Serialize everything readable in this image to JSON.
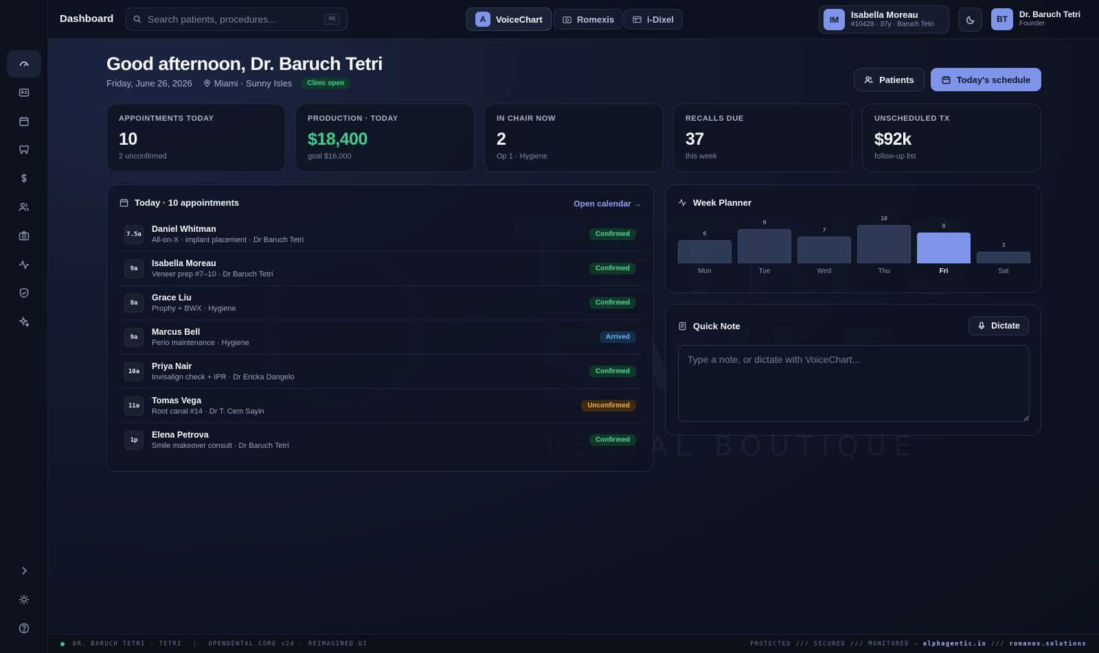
{
  "topbar": {
    "title": "Dashboard",
    "search_placeholder": "Search patients, procedures...",
    "search_shortcut": "⌘K",
    "apps": [
      {
        "label": "VoiceChart",
        "badge": "A",
        "icon": "voicechart-icon",
        "active": true
      },
      {
        "label": "Romexis",
        "icon": "camera-icon",
        "active": false
      },
      {
        "label": "i-Dixel",
        "icon": "image-window-icon",
        "active": false
      }
    ],
    "patient": {
      "initials": "IM",
      "name": "Isabella Moreau",
      "sub": "#10428 · 37y · Baruch Tetri"
    },
    "user": {
      "initials": "BT",
      "name": "Dr. Baruch Tetri",
      "role": "Founder"
    }
  },
  "sidebar": {
    "items": [
      {
        "icon": "gauge-icon",
        "active": true
      },
      {
        "icon": "id-card-icon"
      },
      {
        "icon": "calendar-icon"
      },
      {
        "icon": "tooth-icon"
      },
      {
        "icon": "dollar-icon"
      },
      {
        "icon": "users-icon"
      },
      {
        "icon": "camera-icon"
      },
      {
        "icon": "activity-icon"
      },
      {
        "icon": "shield-icon"
      },
      {
        "icon": "sparkle-icon"
      }
    ],
    "bottom": [
      {
        "icon": "chevron-right-icon"
      },
      {
        "icon": "sun-icon"
      },
      {
        "icon": "help-icon"
      }
    ]
  },
  "watermark": {
    "line1": "TETRI'S",
    "line2": "SMILE",
    "line3": "DENTAL BOUTIQUE"
  },
  "greeting": {
    "title": "Good afternoon, Dr. Baruch Tetri",
    "date": "Friday, June 26, 2026",
    "location": "Miami · Sunny Isles",
    "clinic_status": "Clinic open"
  },
  "actions": {
    "patients_label": "Patients",
    "schedule_label": "Today's schedule"
  },
  "kpis": [
    {
      "label": "APPOINTMENTS TODAY",
      "value": "10",
      "sub": "2 unconfirmed",
      "accent": false
    },
    {
      "label": "PRODUCTION · TODAY",
      "value": "$18,400",
      "sub": "goal $16,000",
      "accent": true
    },
    {
      "label": "IN CHAIR NOW",
      "value": "2",
      "sub": "Op 1 · Hygiene",
      "accent": false
    },
    {
      "label": "RECALLS DUE",
      "value": "37",
      "sub": "this week",
      "accent": false
    },
    {
      "label": "UNSCHEDULED TX",
      "value": "$92k",
      "sub": "follow-up list",
      "accent": false
    }
  ],
  "appointments": {
    "title": "Today · 10 appointments",
    "open_link": "Open calendar →",
    "items": [
      {
        "time": "7.5a",
        "name": "Daniel Whitman",
        "desc": "All-on-X · implant placement · Dr Baruch Tetri",
        "status": "Confirmed",
        "kind": "confirmed"
      },
      {
        "time": "9a",
        "name": "Isabella Moreau",
        "desc": "Veneer prep #7–10 · Dr Baruch Tetri",
        "status": "Confirmed",
        "kind": "confirmed"
      },
      {
        "time": "8a",
        "name": "Grace Liu",
        "desc": "Prophy + BWX · Hygiene",
        "status": "Confirmed",
        "kind": "confirmed"
      },
      {
        "time": "9a",
        "name": "Marcus Bell",
        "desc": "Perio maintenance · Hygiene",
        "status": "Arrived",
        "kind": "arrived"
      },
      {
        "time": "10a",
        "name": "Priya Nair",
        "desc": "Invisalign check + IPR · Dr Ericka Dangelo",
        "status": "Confirmed",
        "kind": "confirmed"
      },
      {
        "time": "11a",
        "name": "Tomas Vega",
        "desc": "Root canal #14 · Dr T. Cem Sayin",
        "status": "Unconfirmed",
        "kind": "unconfirmed"
      },
      {
        "time": "1p",
        "name": "Elena Petrova",
        "desc": "Smile makeover consult · Dr Baruch Tetri",
        "status": "Confirmed",
        "kind": "confirmed"
      }
    ]
  },
  "week_planner": {
    "title": "Week Planner",
    "days": [
      {
        "day": "Mon",
        "count": 6,
        "highlight": false
      },
      {
        "day": "Tue",
        "count": 9,
        "highlight": false
      },
      {
        "day": "Wed",
        "count": 7,
        "highlight": false
      },
      {
        "day": "Thu",
        "count": 10,
        "highlight": false
      },
      {
        "day": "Fri",
        "count": 8,
        "highlight": true
      },
      {
        "day": "Sat",
        "count": 3,
        "highlight": false
      }
    ]
  },
  "quick_note": {
    "title": "Quick Note",
    "dictate_label": "Dictate",
    "placeholder": "Type a note, or dictate with VoiceChart..."
  },
  "footer": {
    "left_a": "DR. BARUCH TETRI · TETRI",
    "left_b": "OPENDENTAL CORE v24 · REIMAGINED UI",
    "right_prefix": "PROTECTED /// SECURED /// MONITORED — ",
    "link1": "alphagentic.io",
    "sep": " /// ",
    "link2": "romanov.solutions"
  },
  "colors": {
    "accent": "#7f95e9",
    "success": "#3ed08f",
    "warning": "#f1b04d",
    "info": "#6cb7f0"
  }
}
